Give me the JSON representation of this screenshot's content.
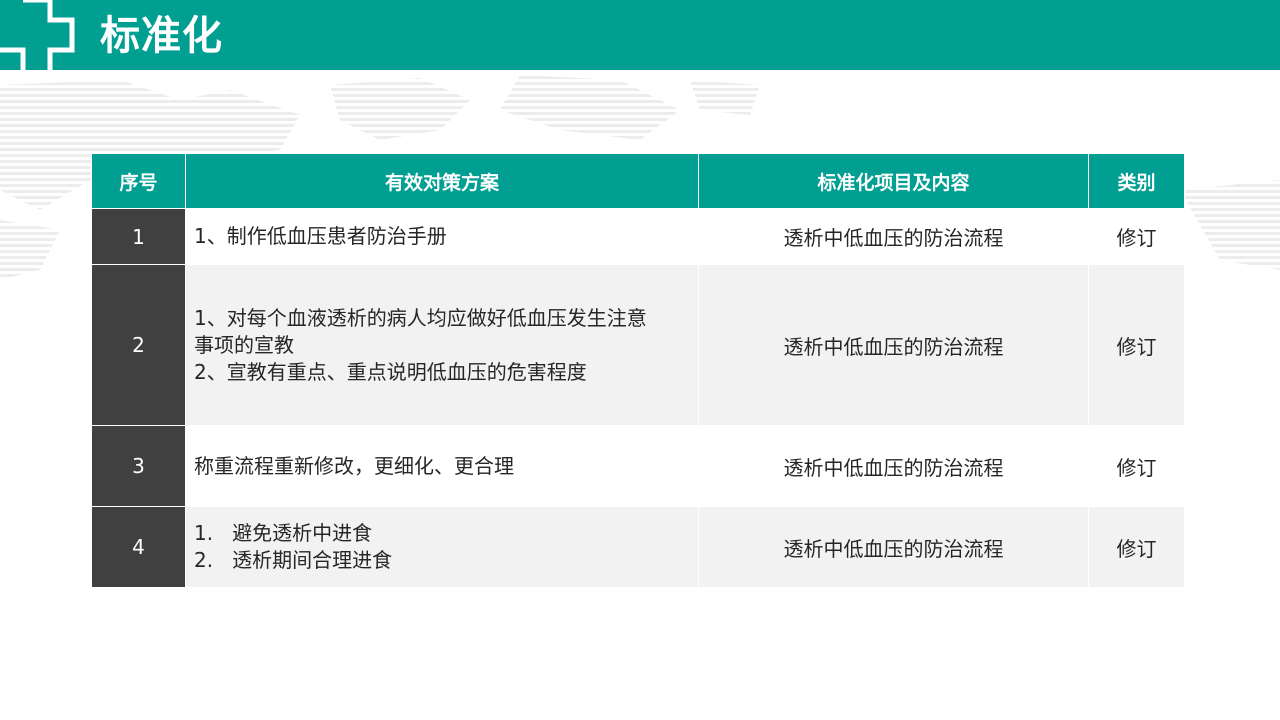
{
  "title": "标准化",
  "table": {
    "headers": [
      "序号",
      "有效对策方案",
      "标准化项目及内容",
      "类别"
    ],
    "rows": [
      {
        "no": "1",
        "measures": [
          "1、制作低血压患者防治手册"
        ],
        "content": "透析中低血压的防治流程",
        "category": "修订"
      },
      {
        "no": "2",
        "measures": [
          "1、对每个血液透析的病人均应做好低血压发生注意",
          "事项的宣教",
          "2、宣教有重点、重点说明低血压的危害程度"
        ],
        "content": "透析中低血压的防治流程",
        "category": "修订"
      },
      {
        "no": "3",
        "measures": [
          "称重流程重新修改，更细化、更合理"
        ],
        "content": "透析中低血压的防治流程",
        "category": "修订"
      },
      {
        "no": "4",
        "measures": [
          "1.   避免透析中进食",
          "2.   透析期间合理进食"
        ],
        "content": "透析中低血压的防治流程",
        "category": "修订"
      }
    ]
  },
  "colors": {
    "header": "#019e92",
    "number_cell": "#404040",
    "alt_row": "#f2f2f2",
    "text": "#262626"
  }
}
